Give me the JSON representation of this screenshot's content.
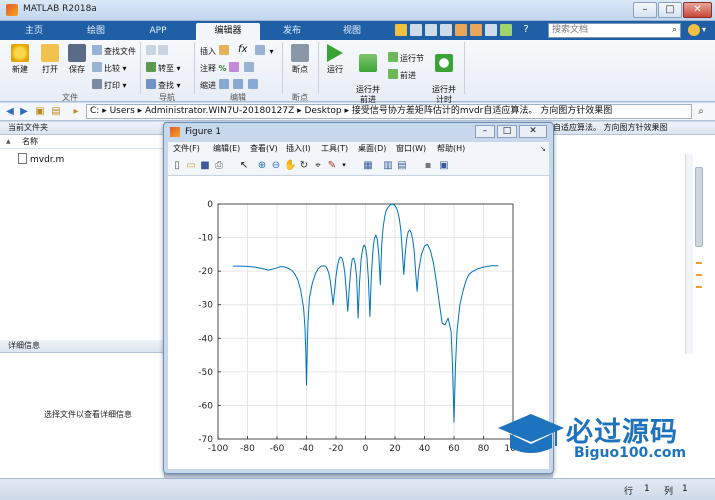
{
  "window": {
    "title": "MATLAB R2018a",
    "min": "–",
    "max": "□",
    "close": "✕"
  },
  "tabs": [
    {
      "label": "主页"
    },
    {
      "label": "绘图"
    },
    {
      "label": "APP"
    },
    {
      "label": "编辑器"
    },
    {
      "label": "发布"
    },
    {
      "label": "视图"
    }
  ],
  "toolbar_quick": {
    "help": "?",
    "search_placeholder": "搜索文档"
  },
  "ribbon": {
    "file_group": {
      "label": "文件",
      "new": "新建",
      "open": "打开",
      "save": "保存",
      "find_files": "查找文件",
      "compare": "比较",
      "print": "打印"
    },
    "nav_group": {
      "label": "导航",
      "goto": "转至",
      "find": "查找"
    },
    "edit_group": {
      "label": "编辑",
      "insert": "插入",
      "comment": "注释",
      "indent": "缩进",
      "fx": "fx"
    },
    "breakpoints_group": {
      "label": "断点",
      "breakpoints": "断点"
    },
    "run_group": {
      "run": "运行",
      "run_advance": "运行并\n前进",
      "run_section": "运行节",
      "advance": "前进",
      "run_time": "运行并\n计时"
    }
  },
  "address": {
    "path": [
      "C:",
      "Users",
      "Administrator.WIN7U-20180127Z",
      "Desktop",
      "接受信号协方差矩阵估计的mvdr自适应算法。 方向图方针效果图"
    ]
  },
  "left_pane": {
    "title": "当前文件夹",
    "column": "名称",
    "sort_arrow": "▲",
    "files": [
      {
        "name": "mvdr.m"
      }
    ],
    "details_title": "详细信息",
    "details_hint": "选择文件以查看详细信息"
  },
  "right_pane": {
    "header_text": "自适应算法。 方向图方针效果图"
  },
  "status": {
    "row_label": "行",
    "row_value": "1",
    "col_label": "列",
    "col_value": "1"
  },
  "figure": {
    "title": "Figure 1",
    "menus": [
      "文件(F)",
      "编辑(E)",
      "查看(V)",
      "插入(I)",
      "工具(T)",
      "桌面(D)",
      "窗口(W)",
      "帮助(H)"
    ]
  },
  "watermark": {
    "text": "必过源码",
    "sub": "Biguo100.com"
  },
  "colors": {
    "accent": "#1f5fa6",
    "line": "#0072bd",
    "watermark": "#1e73be"
  },
  "chart_data": {
    "type": "line",
    "xlim": [
      -100,
      100
    ],
    "ylim": [
      -70,
      0
    ],
    "xticks": [
      -100,
      -80,
      -60,
      -40,
      -20,
      0,
      20,
      40,
      60,
      80,
      100
    ],
    "yticks": [
      0,
      -10,
      -20,
      -30,
      -40,
      -50,
      -60,
      -70
    ],
    "grid": true,
    "series": [
      {
        "x": [
          -90,
          -85,
          -80,
          -75,
          -70,
          -66,
          -62,
          -58,
          -55,
          -52,
          -50,
          -48,
          -46,
          -44,
          -42,
          -41,
          -40.5,
          -40,
          -39.5,
          -39,
          -38,
          -36,
          -34,
          -32,
          -30,
          -28,
          -27,
          -26,
          -25,
          -24,
          -23,
          -22,
          -21,
          -20,
          -19,
          -18,
          -17,
          -16,
          -15,
          -14,
          -13,
          -12,
          -11,
          -10,
          -9,
          -8,
          -7,
          -6,
          -5,
          -4,
          -3,
          -2,
          -1,
          0,
          1,
          2,
          3,
          4,
          5,
          6,
          7,
          8,
          9,
          10,
          11,
          12,
          13,
          14,
          15,
          16,
          17,
          18,
          19,
          20,
          21,
          22,
          23,
          24,
          25,
          26,
          27,
          28,
          29,
          30,
          31,
          32,
          33,
          34,
          35,
          36,
          38,
          40,
          42,
          44,
          46,
          48,
          50,
          52,
          54,
          56,
          58,
          59,
          60,
          61,
          62,
          64,
          66,
          68,
          70,
          72,
          76,
          80,
          85,
          90
        ],
        "y": [
          -18.5,
          -18.5,
          -18.6,
          -18.8,
          -19.2,
          -19.7,
          -19.3,
          -18.7,
          -18.7,
          -19.2,
          -19.8,
          -20.8,
          -22.5,
          -25.5,
          -31,
          -37,
          -44,
          -54,
          -44,
          -35,
          -28,
          -23.5,
          -20.8,
          -19.2,
          -18.5,
          -18.4,
          -18.6,
          -19.3,
          -20.4,
          -22.5,
          -26,
          -30,
          -26,
          -21.5,
          -18.4,
          -16.6,
          -15.8,
          -16.1,
          -17.6,
          -20.6,
          -26,
          -32,
          -25,
          -19.5,
          -16.5,
          -16.1,
          -17.8,
          -22,
          -34,
          -23,
          -16.5,
          -13.5,
          -12.2,
          -12.8,
          -16,
          -22.5,
          -33.5,
          -21,
          -14,
          -10.4,
          -9.2,
          -10.5,
          -15,
          -24,
          -12.2,
          -6.8,
          -3.8,
          -2,
          -1.2,
          -0.6,
          -0.2,
          0,
          -0.2,
          -0.5,
          -1.2,
          -2.5,
          -4.5,
          -8,
          -14.5,
          -21,
          -14.5,
          -10.2,
          -8.2,
          -7.8,
          -8.5,
          -10.5,
          -14,
          -20.5,
          -26,
          -20,
          -15,
          -12.5,
          -12,
          -13.8,
          -17.5,
          -23,
          -29.5,
          -35.5,
          -36,
          -34,
          -38,
          -48,
          -65,
          -48,
          -38,
          -30,
          -26,
          -23,
          -21,
          -20.3,
          -19.3,
          -18.8,
          -18.4,
          -18.4
        ]
      }
    ]
  }
}
